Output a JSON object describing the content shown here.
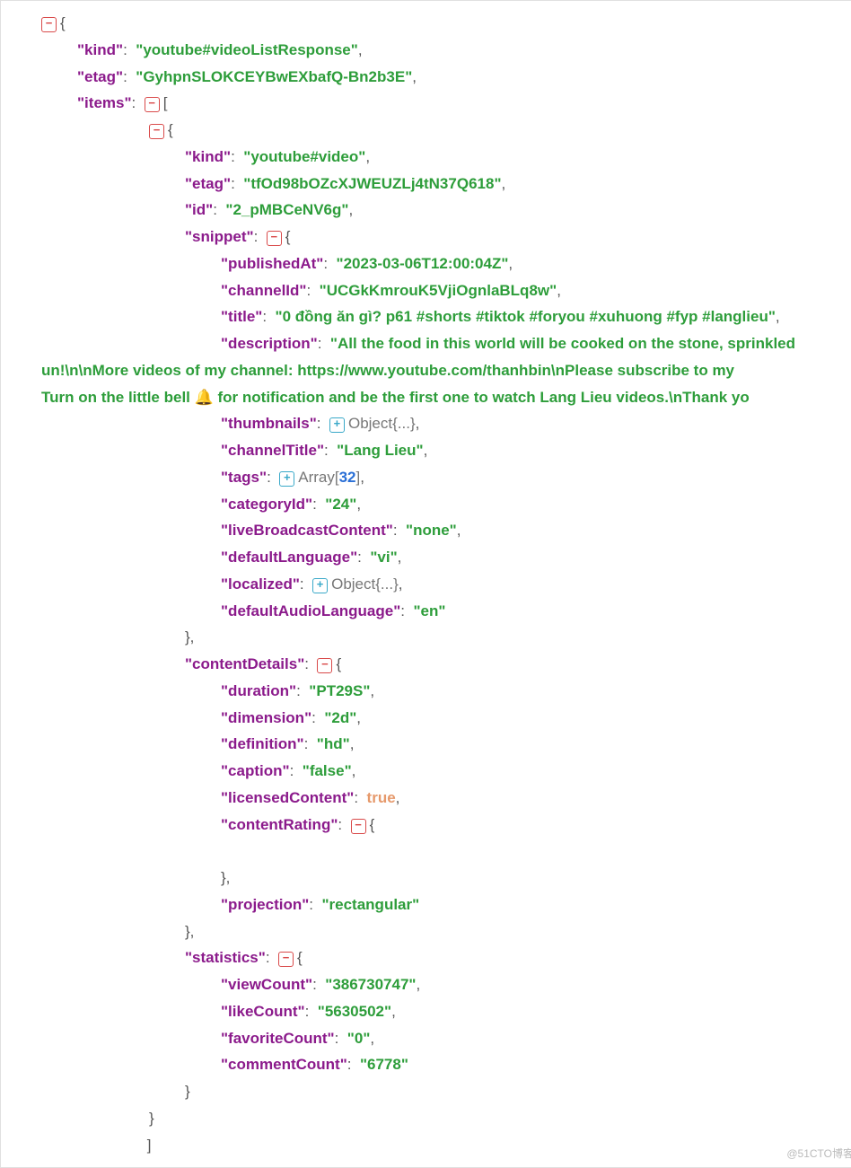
{
  "json": {
    "kind": "youtube#videoListResponse",
    "etag": "GyhpnSLOKCEYBwEXbafQ-Bn2b3E",
    "items": [
      {
        "kind": "youtube#video",
        "etag": "tfOd98bOZcXJWEUZLj4tN37Q618",
        "id": "2_pMBCeNV6g",
        "snippet": {
          "publishedAt": "2023-03-06T12:00:04Z",
          "channelId": "UCGkKmrouK5VjiOgnlaBLq8w",
          "title": "0 đồng ăn gì? p61 #shorts #tiktok #foryou #xuhuong #fyp #langlieu",
          "description_line1": "\"All the food in this world will be cooked on the stone, sprinkled",
          "description_line2": "un!\\n\\nMore videos of my channel: https://www.youtube.com/thanhbin\\nPlease subscribe to my",
          "description_line3": "Turn on the little bell 🔔 for notification and be the first one to watch Lang Lieu videos.\\nThank yo",
          "thumbnails_meta": "Object{...}",
          "channelTitle": "Lang Lieu",
          "tags_meta_prefix": "Array[",
          "tags_count": "32",
          "tags_meta_suffix": "]",
          "categoryId": "24",
          "liveBroadcastContent": "none",
          "defaultLanguage": "vi",
          "localized_meta": "Object{...}",
          "defaultAudioLanguage": "en"
        },
        "contentDetails": {
          "duration": "PT29S",
          "dimension": "2d",
          "definition": "hd",
          "caption": "false",
          "licensedContent": "true",
          "projection": "rectangular"
        },
        "statistics": {
          "viewCount": "386730747",
          "likeCount": "5630502",
          "favoriteCount": "0",
          "commentCount": "6778"
        }
      }
    ]
  },
  "labels": {
    "kind": "\"kind\"",
    "etag": "\"etag\"",
    "items": "\"items\"",
    "id": "\"id\"",
    "snippet": "\"snippet\"",
    "publishedAt": "\"publishedAt\"",
    "channelId": "\"channelId\"",
    "title": "\"title\"",
    "description": "\"description\"",
    "thumbnails": "\"thumbnails\"",
    "channelTitle": "\"channelTitle\"",
    "tags": "\"tags\"",
    "categoryId": "\"categoryId\"",
    "liveBroadcastContent": "\"liveBroadcastContent\"",
    "defaultLanguage": "\"defaultLanguage\"",
    "localized": "\"localized\"",
    "defaultAudioLanguage": "\"defaultAudioLanguage\"",
    "contentDetails": "\"contentDetails\"",
    "duration": "\"duration\"",
    "dimension": "\"dimension\"",
    "definition": "\"definition\"",
    "caption": "\"caption\"",
    "licensedContent": "\"licensedContent\"",
    "contentRating": "\"contentRating\"",
    "projection": "\"projection\"",
    "statistics": "\"statistics\"",
    "viewCount": "\"viewCount\"",
    "likeCount": "\"likeCount\"",
    "favoriteCount": "\"favoriteCount\"",
    "commentCount": "\"commentCount\""
  },
  "watermark": "@51CTO博客"
}
